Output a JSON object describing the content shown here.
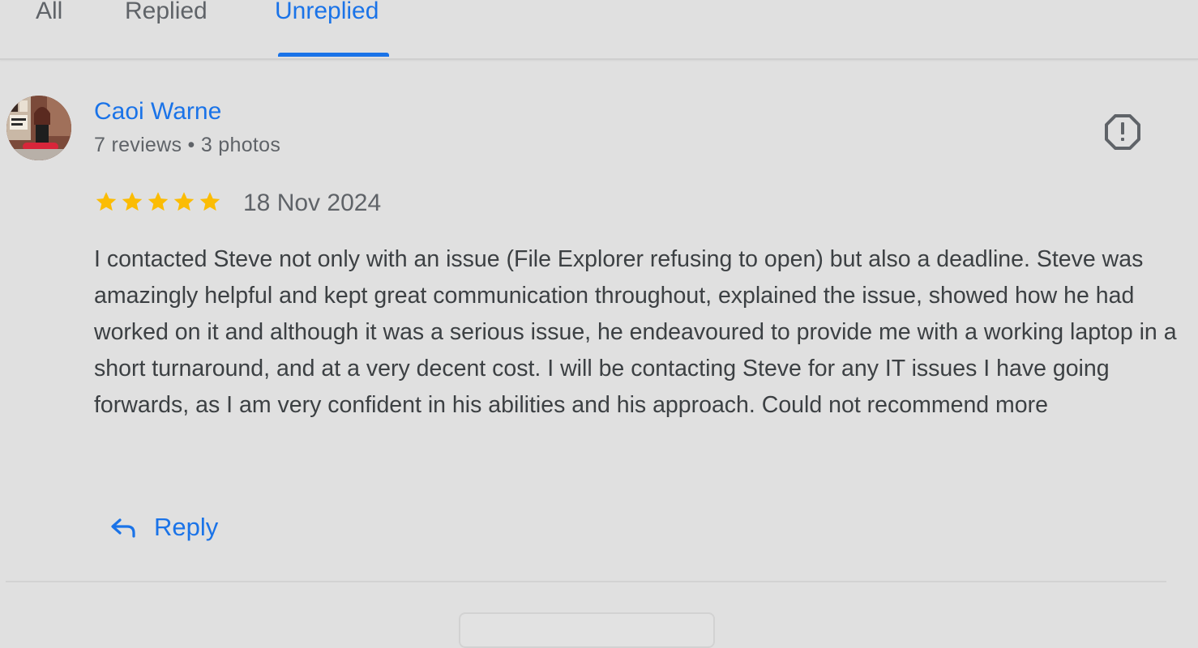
{
  "tabs": [
    {
      "label": "All"
    },
    {
      "label": "Replied"
    },
    {
      "label": "Unreplied",
      "active": true
    }
  ],
  "review": {
    "reviewer_name": "Caoi Warne",
    "reviewer_meta": "7 reviews • 3 photos",
    "rating": 5,
    "rating_max": 5,
    "date": "18 Nov 2024",
    "text": "I contacted Steve not only with an issue (File Explorer refusing to open) but also a deadline. Steve was amazingly helpful and kept great communication throughout, explained the issue, showed how he had worked on it and although it was a serious issue, he endeavoured to provide me with a working laptop in a short turnaround, and at a very decent cost. I will be contacting Steve for any IT issues I have going forwards, as I am very confident in his abilities and his approach. Could not recommend more",
    "reply_label": "Reply"
  },
  "icons": {
    "report": "report-flag-icon",
    "reply": "reply-arrow-icon",
    "star": "star-icon"
  },
  "colors": {
    "accent": "#1a73e8",
    "star": "#fbbc04",
    "background": "#e0e0e0",
    "text": "#3c4043",
    "muted": "#5f6368"
  }
}
